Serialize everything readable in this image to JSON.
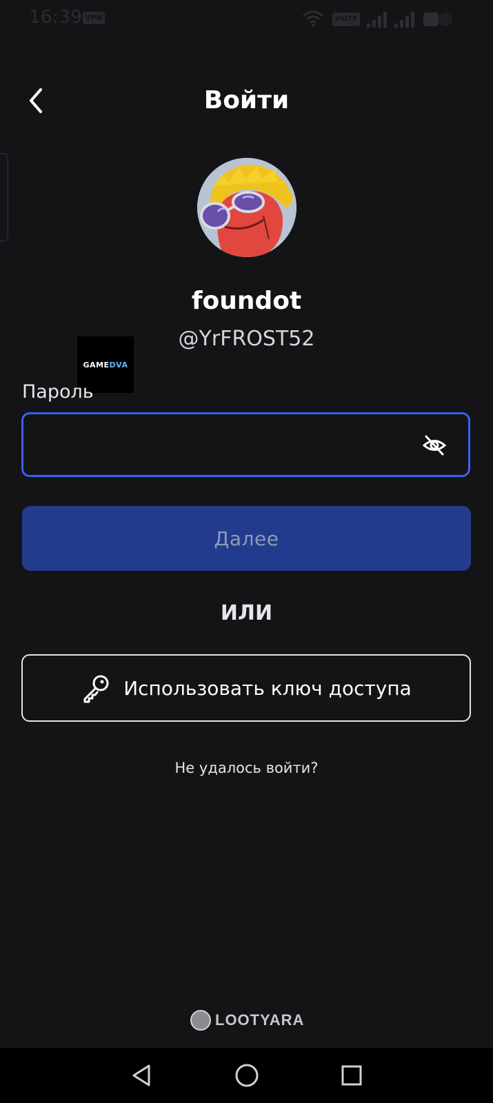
{
  "status_bar": {
    "time": "16:39",
    "vpn_label": "VPN",
    "volte_label": "VoLTE",
    "icons": [
      "wifi-icon",
      "volte-icon",
      "signal-icon",
      "signal-icon",
      "battery-icon"
    ]
  },
  "header": {
    "title": "Войти",
    "back_icon": "chevron-left-icon"
  },
  "profile": {
    "display_name": "foundot",
    "handle": "@YrFROST52",
    "avatar_icon": "avatar-character"
  },
  "watermark": {
    "game": "GAME",
    "dva": "DVA"
  },
  "password": {
    "label": "Пароль",
    "value": "",
    "visibility_icon": "eye-off-icon",
    "focus_color": "#3e5ff2"
  },
  "actions": {
    "next_label": "Далее",
    "next_color": "#233b8c",
    "or_label": "ИЛИ",
    "passkey_label": "Использовать ключ доступа",
    "passkey_icon": "key-icon",
    "trouble_label": "Не удалось войти?"
  },
  "branding": {
    "lootyara": "LOOTYARA"
  },
  "nav": {
    "icons": [
      "back-triangle-icon",
      "home-circle-icon",
      "recents-square-icon"
    ]
  }
}
